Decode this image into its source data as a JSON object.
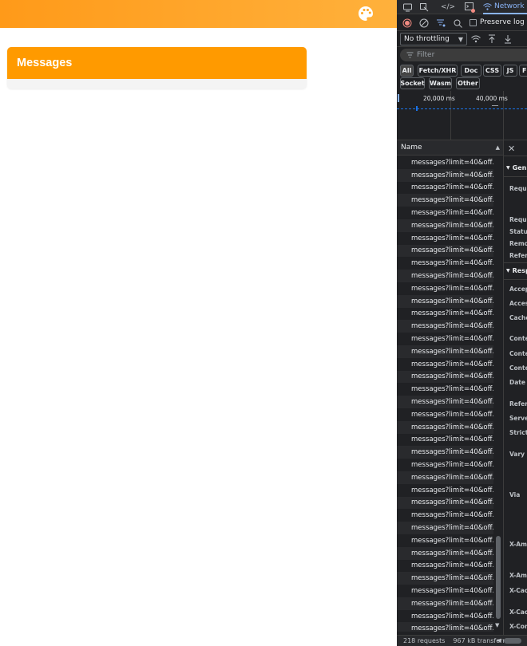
{
  "app": {
    "header": {
      "icon": "palette-icon"
    },
    "messages_card": {
      "title": "Messages"
    }
  },
  "devtools": {
    "tabs": {
      "network_label": "Network"
    },
    "toolbar": {
      "preserve_log_label": "Preserve log",
      "throttling_value": "No throttling"
    },
    "filter": {
      "placeholder": "Filter"
    },
    "type_chips": [
      "All",
      "Fetch/XHR",
      "Doc",
      "CSS",
      "JS",
      "F",
      "Socket",
      "Wasm",
      "Other"
    ],
    "overview": {
      "ticks": [
        "20,000 ms",
        "40,000 ms"
      ]
    },
    "table": {
      "name_header": "Name",
      "rows": [
        "messages?limit=40&off...",
        "messages?limit=40&off...",
        "messages?limit=40&off...",
        "messages?limit=40&off...",
        "messages?limit=40&off...",
        "messages?limit=40&off...",
        "messages?limit=40&off...",
        "messages?limit=40&off...",
        "messages?limit=40&off...",
        "messages?limit=40&off...",
        "messages?limit=40&off...",
        "messages?limit=40&off...",
        "messages?limit=40&off...",
        "messages?limit=40&off...",
        "messages?limit=40&off...",
        "messages?limit=40&off...",
        "messages?limit=40&off...",
        "messages?limit=40&off...",
        "messages?limit=40&off...",
        "messages?limit=40&off...",
        "messages?limit=40&off...",
        "messages?limit=40&off...",
        "messages?limit=40&off...",
        "messages?limit=40&off...",
        "messages?limit=40&off...",
        "messages?limit=40&off...",
        "messages?limit=40&off...",
        "messages?limit=40&off...",
        "messages?limit=40&off...",
        "messages?limit=40&off...",
        "messages?limit=40&off...",
        "messages?limit=40&off...",
        "messages?limit=40&off...",
        "messages?limit=40&off...",
        "messages?limit=40&off...",
        "messages?limit=40&off...",
        "messages?limit=40&off...",
        "messages?limit=40&off..."
      ]
    },
    "details": {
      "general_heading": "Gen",
      "general_keys": [
        "Reque",
        "Reque",
        "Status",
        "Remot",
        "Referr"
      ],
      "response_heading": "Resp",
      "response_keys": [
        "Accep",
        "Access",
        "Cache",
        "Conter",
        "Conter",
        "Conter",
        "Date",
        "Referr",
        "Server",
        "Strict-T",
        "Vary",
        "Via",
        "X-Ama",
        "X-Ama",
        "X-Cach",
        "X-Cach",
        "X-Con"
      ]
    },
    "status": {
      "requests": "218 requests",
      "transferred": "967 kB transferre"
    },
    "colors": {
      "accent": "#8ab4f8",
      "record_red": "#f28b82",
      "brand_orange": "#ff9a00"
    }
  }
}
